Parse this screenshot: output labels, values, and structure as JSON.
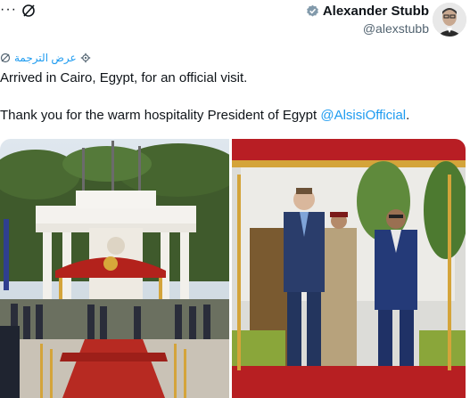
{
  "header": {
    "more_label": "···",
    "author_name": "Alexander Stubb",
    "author_handle": "@alexstubb",
    "icons": [
      "more-icon",
      "mute-slash-icon",
      "verified-badge-icon",
      "avatar"
    ]
  },
  "translate": {
    "label": "عرض الترجمة",
    "icons": [
      "gear-icon",
      "translate-icon"
    ]
  },
  "tweet": {
    "line1": "Arrived in Cairo, Egypt, for an official visit.",
    "line2_prefix": "Thank you for the warm hospitality President of Egypt ",
    "mention": "@AlsisiOfficial",
    "line2_suffix": "."
  },
  "colors": {
    "link": "#1d9bf0",
    "text": "#0f1419",
    "muted": "#536471"
  }
}
